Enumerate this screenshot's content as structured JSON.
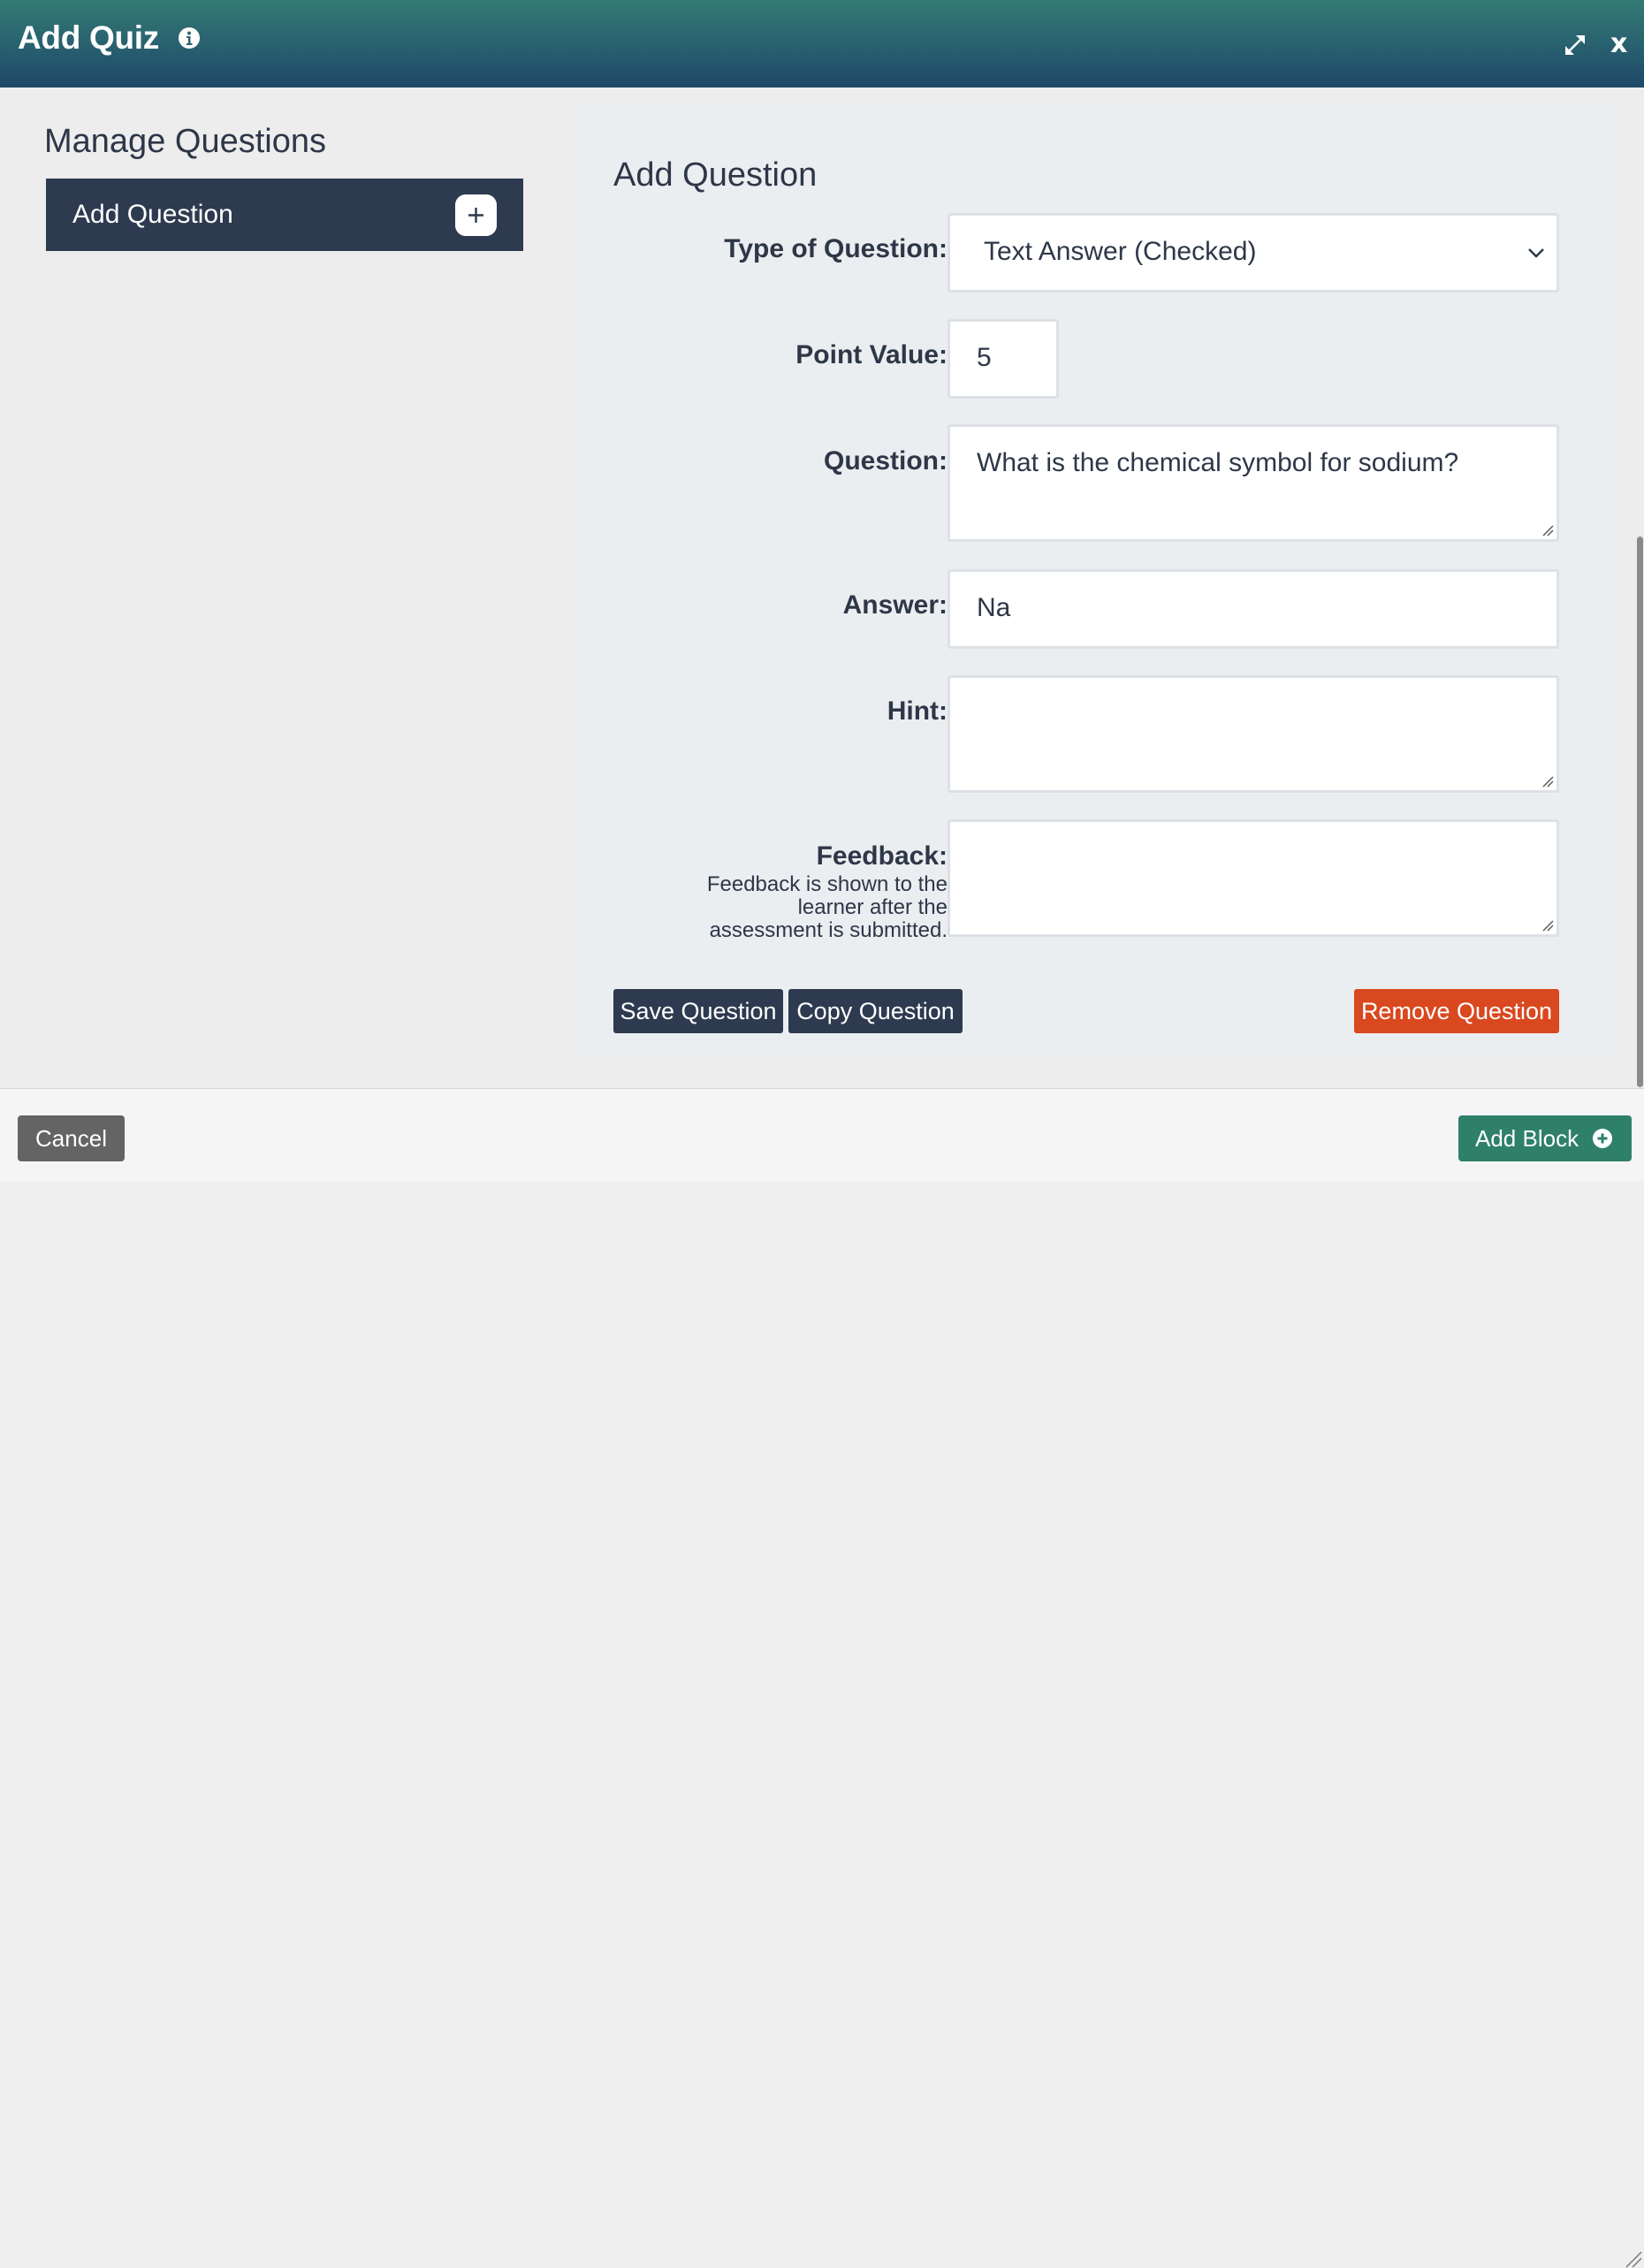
{
  "dialog": {
    "title": "Add Quiz",
    "close_label": "x"
  },
  "sidebar": {
    "title": "Manage Questions",
    "add_question_label": "Add Question"
  },
  "form": {
    "title": "Add Question",
    "type_label": "Type of Question:",
    "type_value": "Text Answer (Checked)",
    "points_label": "Point Value:",
    "points_value": "5",
    "question_label": "Question:",
    "question_value": "What is the chemical symbol for sodium?",
    "answer_label": "Answer:",
    "answer_value": "Na",
    "hint_label": "Hint:",
    "hint_value": "",
    "feedback_label": "Feedback:",
    "feedback_help_1": "Feedback is shown to the",
    "feedback_help_2": "learner after the",
    "feedback_help_3": "assessment is submitted.",
    "feedback_value": "",
    "save_label": "Save Question",
    "copy_label": "Copy Question",
    "remove_label": "Remove Question"
  },
  "footer": {
    "cancel_label": "Cancel",
    "add_block_label": "Add Block"
  },
  "colors": {
    "header_top": "#337a72",
    "header_bottom": "#1f4869",
    "dark_button": "#2d3a4f",
    "danger_button": "#d9481f",
    "success_button": "#2f8068",
    "cancel_button": "#646464"
  }
}
